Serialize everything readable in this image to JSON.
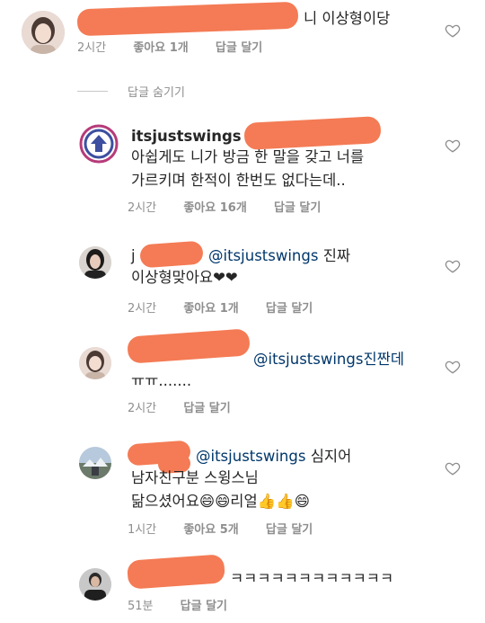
{
  "comments": [
    {
      "id": "c1",
      "text_after": "니 이상형이당",
      "time": "2시간",
      "likes": "좋아요 1개",
      "reply": "답글 달기"
    },
    {
      "id": "c2",
      "username": "itsjustswings",
      "mention_prefix": "@",
      "line1": "아쉽게도 니가 방금 한 말을 갖고 너를",
      "line2": "가르키며 한적이 한번도 없다는데..",
      "time": "2시간",
      "likes": "좋아요 16개",
      "reply": "답글 달기"
    },
    {
      "id": "c3",
      "username_initial": "j",
      "mention": "@itsjustswings",
      "line1_after": "진짜",
      "line2": "이상형맞아요❤❤",
      "time": "2시간",
      "likes": "좋아요 1개",
      "reply": "답글 달기"
    },
    {
      "id": "c4",
      "mention": "@itsjustswings진짠데",
      "line2": "ㅠㅠ.......",
      "time": "2시간",
      "reply": "답글 달기"
    },
    {
      "id": "c5",
      "mention": "@itsjustswings",
      "line1_after": "심지어",
      "line2": "남자친구분 스윙스님",
      "line3": "닮으셨어요😄😄리얼👍👍😄",
      "time": "1시간",
      "likes": "좋아요 5개",
      "reply": "답글 달기"
    },
    {
      "id": "c6",
      "text_after": "ㅋㅋㅋㅋㅋㅋㅋㅋㅋㅋㅋㅋ",
      "time": "51분",
      "reply": "답글 달기"
    }
  ],
  "hide_replies": "답글 숨기기",
  "colors": {
    "redaction": "#f47b55",
    "mention": "#00376b",
    "meta": "#8e8e8e"
  },
  "icons": [
    "heart-outline-icon",
    "avatar-arrow-icon"
  ]
}
